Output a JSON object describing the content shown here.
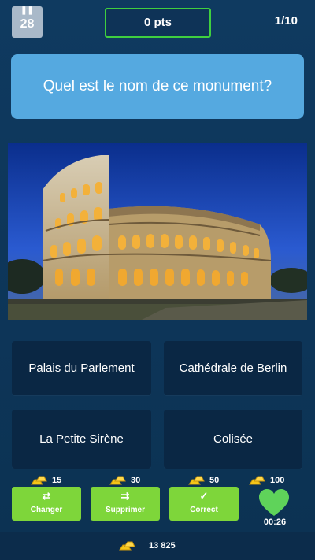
{
  "header": {
    "pause_icon": "pause-icon",
    "timer_value": "28",
    "score": "0 pts",
    "progress": "1/10"
  },
  "question": {
    "text": "Quel est le nom de ce monument?"
  },
  "image": {
    "subject": "colosseum-photo"
  },
  "answers": [
    "Palais du Parlement",
    "Cathédrale de Berlin",
    "La Petite Sirène",
    "Colisée"
  ],
  "powerups": [
    {
      "cost": "15",
      "label": "Changer",
      "icon": "swap-icon"
    },
    {
      "cost": "30",
      "label": "Supprimer",
      "icon": "shuffle-icon"
    },
    {
      "cost": "50",
      "label": "Correct",
      "icon": "check-icon"
    }
  ],
  "life": {
    "cost": "100",
    "icon": "heart-icon",
    "timer": "00:26"
  },
  "balance": {
    "coins": "13 825",
    "icon": "gold-bars-icon"
  },
  "colors": {
    "background": "#0f3a60",
    "question_bg": "#55a9e0",
    "score_border": "#3fcf3f",
    "answer_bg": "#0a2744",
    "powerup_bg": "#7ed63a",
    "heart": "#5fd35a",
    "gold": "#f5c518"
  }
}
